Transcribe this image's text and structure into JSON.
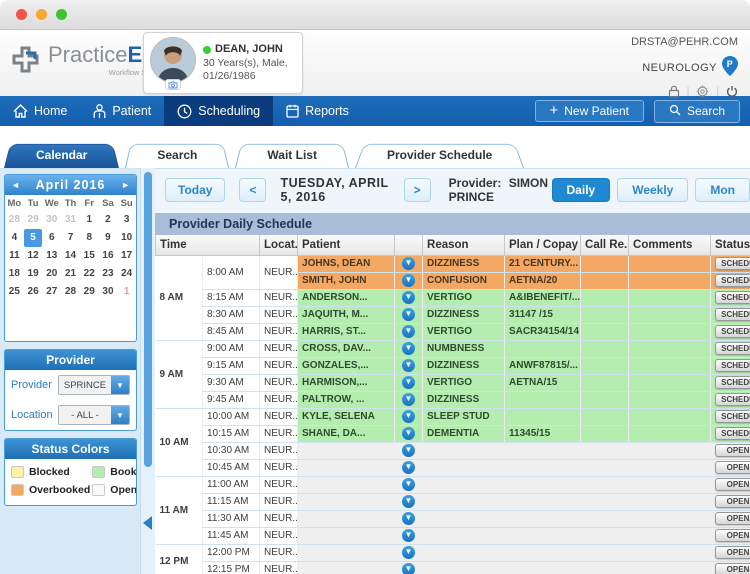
{
  "window": {
    "controls": [
      "close",
      "minimize",
      "zoom"
    ]
  },
  "header": {
    "logo": {
      "brand_practice": "Practice",
      "brand_ehr": "EHR",
      "tagline": "Workflow Simplified"
    },
    "patient_card": {
      "name": "DEAN, JOHN",
      "details_line1": "30 Years(s), Male,",
      "details_line2": "01/26/1986",
      "presence_color": "#35cf35"
    },
    "account_email": "DRSTA@PEHR.COM",
    "specialty": "NEUROLOGY"
  },
  "nav": {
    "items": [
      {
        "label": "Home",
        "icon": "home-icon",
        "active": false
      },
      {
        "label": "Patient",
        "icon": "patient-icon",
        "active": false
      },
      {
        "label": "Scheduling",
        "icon": "clock-icon",
        "active": true
      },
      {
        "label": "Reports",
        "icon": "reports-icon",
        "active": false
      }
    ],
    "new_patient_label": "New Patient",
    "search_label": "Search"
  },
  "tabs": [
    {
      "label": "Calendar",
      "active": true
    },
    {
      "label": "Search",
      "active": false
    },
    {
      "label": "Wait List",
      "active": false
    },
    {
      "label": "Provider Schedule",
      "active": false
    }
  ],
  "sidebar": {
    "calendar": {
      "month_year": "April  2016",
      "prev": "◄",
      "next": "►",
      "day_headers": [
        "Mo",
        "Tu",
        "We",
        "Th",
        "Fr",
        "Sa",
        "Su"
      ],
      "weeks": [
        [
          {
            "t": "28",
            "m": 1
          },
          {
            "t": "29",
            "m": 1
          },
          {
            "t": "30",
            "m": 1
          },
          {
            "t": "31",
            "m": 1
          },
          {
            "t": "1"
          },
          {
            "t": "2"
          },
          {
            "t": "3"
          }
        ],
        [
          {
            "t": "4"
          },
          {
            "t": "5",
            "sel": 1
          },
          {
            "t": "6"
          },
          {
            "t": "7"
          },
          {
            "t": "8"
          },
          {
            "t": "9"
          },
          {
            "t": "10"
          }
        ],
        [
          {
            "t": "11"
          },
          {
            "t": "12"
          },
          {
            "t": "13"
          },
          {
            "t": "14"
          },
          {
            "t": "15"
          },
          {
            "t": "16"
          },
          {
            "t": "17"
          }
        ],
        [
          {
            "t": "18"
          },
          {
            "t": "19"
          },
          {
            "t": "20"
          },
          {
            "t": "21"
          },
          {
            "t": "22"
          },
          {
            "t": "23"
          },
          {
            "t": "24"
          }
        ],
        [
          {
            "t": "25"
          },
          {
            "t": "26"
          },
          {
            "t": "27"
          },
          {
            "t": "28"
          },
          {
            "t": "29"
          },
          {
            "t": "30"
          },
          {
            "t": "1",
            "nx": 1
          }
        ]
      ]
    },
    "provider_panel": {
      "title": "Provider",
      "fields": [
        {
          "label": "Provider",
          "value": "SPRINCE"
        },
        {
          "label": "Location",
          "value": "- ALL -"
        }
      ]
    },
    "status_colors": {
      "title": "Status Colors",
      "items": [
        {
          "label": "Blocked",
          "color": "#f8f3a6"
        },
        {
          "label": "Booked",
          "color": "#b5edb0"
        },
        {
          "label": "Overbooked",
          "color": "#f3a964"
        },
        {
          "label": "Open",
          "color": "#fafafa"
        }
      ]
    }
  },
  "toolbar": {
    "today": "Today",
    "prev": "<",
    "next": ">",
    "date": "TUESDAY, APRIL 5, 2016",
    "provider_label": "Provider:",
    "provider_name": "SIMON PRINCE",
    "views": [
      {
        "label": "Daily",
        "active": true
      },
      {
        "label": "Weekly",
        "active": false
      },
      {
        "label": "Mon",
        "active": false
      }
    ]
  },
  "schedule": {
    "title": "Provider Daily Schedule",
    "columns": [
      "Time",
      "Locat...",
      "Patient",
      "",
      "Reason",
      "Plan / Copay",
      "Call Re...",
      "Comments",
      "Status"
    ],
    "row_colors": {
      "overbooked": "#f3a964",
      "booked": "#b5edb0",
      "open": "#efefef"
    },
    "groups": [
      {
        "hour": "8 AM",
        "slots": [
          {
            "time": "8:00 AM",
            "location": "NEUR...",
            "rows": [
              {
                "patient": "JOHNS, DEAN",
                "reason": "DIZZINESS",
                "plan": "21 CENTURY...",
                "call": "",
                "comments": "",
                "status": "SCHEDU",
                "type": "overbooked"
              },
              {
                "patient": "SMITH, JOHN",
                "reason": "CONFUSION",
                "plan": "AETNA/20",
                "call": "",
                "comments": "",
                "status": "SCHEDU",
                "type": "overbooked"
              }
            ]
          },
          {
            "time": "8:15 AM",
            "location": "NEUR...",
            "rows": [
              {
                "patient": "ANDERSON...",
                "reason": "VERTIGO",
                "plan": "A&IBENEFIT/...",
                "call": "",
                "comments": "",
                "status": "SCHEDU",
                "type": "booked"
              }
            ]
          },
          {
            "time": "8:30 AM",
            "location": "NEUR...",
            "rows": [
              {
                "patient": "JAQUITH, M...",
                "reason": "DIZZINESS",
                "plan": "31147 /15",
                "call": "",
                "comments": "",
                "status": "SCHEDU",
                "type": "booked"
              }
            ]
          },
          {
            "time": "8:45 AM",
            "location": "NEUR...",
            "rows": [
              {
                "patient": "HARRIS, ST...",
                "reason": "VERTIGO",
                "plan": "SACR34154/14",
                "call": "",
                "comments": "",
                "status": "SCHEDU",
                "type": "booked"
              }
            ]
          }
        ]
      },
      {
        "hour": "9 AM",
        "slots": [
          {
            "time": "9:00 AM",
            "location": "NEUR...",
            "rows": [
              {
                "patient": "CROSS, DAV...",
                "reason": "NUMBNESS",
                "plan": "",
                "call": "",
                "comments": "",
                "status": "SCHEDU",
                "type": "booked"
              }
            ]
          },
          {
            "time": "9:15 AM",
            "location": "NEUR...",
            "rows": [
              {
                "patient": "GONZALES,...",
                "reason": "DIZZINESS",
                "plan": "ANWF87815/...",
                "call": "",
                "comments": "",
                "status": "SCHEDU",
                "type": "booked"
              }
            ]
          },
          {
            "time": "9:30 AM",
            "location": "NEUR...",
            "rows": [
              {
                "patient": "HARMISON,...",
                "reason": "VERTIGO",
                "plan": "AETNA/15",
                "call": "",
                "comments": "",
                "status": "SCHEDU",
                "type": "booked"
              }
            ]
          },
          {
            "time": "9:45 AM",
            "location": "NEUR...",
            "rows": [
              {
                "patient": "PALTROW, ...",
                "reason": "DIZZINESS",
                "plan": "",
                "call": "",
                "comments": "",
                "status": "SCHEDU",
                "type": "booked"
              }
            ]
          }
        ]
      },
      {
        "hour": "10 AM",
        "slots": [
          {
            "time": "10:00 AM",
            "location": "NEUR...",
            "rows": [
              {
                "patient": "KYLE, SELENA",
                "reason": "SLEEP STUD",
                "plan": "",
                "call": "",
                "comments": "",
                "status": "SCHEDU",
                "type": "booked"
              }
            ]
          },
          {
            "time": "10:15 AM",
            "location": "NEUR...",
            "rows": [
              {
                "patient": "SHANE, DA...",
                "reason": "DEMENTIA",
                "plan": "11345/15",
                "call": "",
                "comments": "",
                "status": "SCHEDU",
                "type": "booked"
              }
            ]
          },
          {
            "time": "10:30 AM",
            "location": "NEUR...",
            "rows": [
              {
                "patient": "",
                "reason": "",
                "plan": "",
                "call": "",
                "comments": "",
                "status": "OPEN",
                "type": "open"
              }
            ]
          },
          {
            "time": "10:45 AM",
            "location": "NEUR...",
            "rows": [
              {
                "patient": "",
                "reason": "",
                "plan": "",
                "call": "",
                "comments": "",
                "status": "OPEN",
                "type": "open"
              }
            ]
          }
        ]
      },
      {
        "hour": "11 AM",
        "slots": [
          {
            "time": "11:00 AM",
            "location": "NEUR...",
            "rows": [
              {
                "patient": "",
                "reason": "",
                "plan": "",
                "call": "",
                "comments": "",
                "status": "OPEN",
                "type": "open"
              }
            ]
          },
          {
            "time": "11:15 AM",
            "location": "NEUR...",
            "rows": [
              {
                "patient": "",
                "reason": "",
                "plan": "",
                "call": "",
                "comments": "",
                "status": "OPEN",
                "type": "open"
              }
            ]
          },
          {
            "time": "11:30 AM",
            "location": "NEUR...",
            "rows": [
              {
                "patient": "",
                "reason": "",
                "plan": "",
                "call": "",
                "comments": "",
                "status": "OPEN",
                "type": "open"
              }
            ]
          },
          {
            "time": "11:45 AM",
            "location": "NEUR...",
            "rows": [
              {
                "patient": "",
                "reason": "",
                "plan": "",
                "call": "",
                "comments": "",
                "status": "OPEN",
                "type": "open"
              }
            ]
          }
        ]
      },
      {
        "hour": "12 PM",
        "slots": [
          {
            "time": "12:00 PM",
            "location": "NEUR...",
            "rows": [
              {
                "patient": "",
                "reason": "",
                "plan": "",
                "call": "",
                "comments": "",
                "status": "OPEN",
                "type": "open"
              }
            ]
          },
          {
            "time": "12:15 PM",
            "location": "NEUR...",
            "rows": [
              {
                "patient": "",
                "reason": "",
                "plan": "",
                "call": "",
                "comments": "",
                "status": "OPEN",
                "type": "open"
              }
            ]
          }
        ]
      }
    ]
  }
}
